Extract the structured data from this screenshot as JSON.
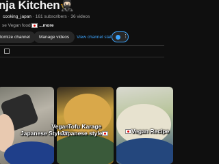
{
  "channel": {
    "title": "nja Kitchen🥷🏻",
    "handle": "cooking_japan",
    "stats": "· 161 subscribers · 36 videos",
    "description": "se Vegan food",
    "more": "...more"
  },
  "buttons": {
    "customize": "tomize channel",
    "manage": "Manage videos",
    "stats": "View channel stats"
  },
  "videos": [
    {
      "line1": "Vegan",
      "line2": "Japanese Style"
    },
    {
      "line1": "Tofu Karage",
      "line2": "Japanese style"
    },
    {
      "line1": "Vegan Recipe",
      "line2": ""
    }
  ],
  "colors": {
    "background": "#0f0f0f",
    "accent": "#3ea6ff",
    "button": "#272727"
  }
}
